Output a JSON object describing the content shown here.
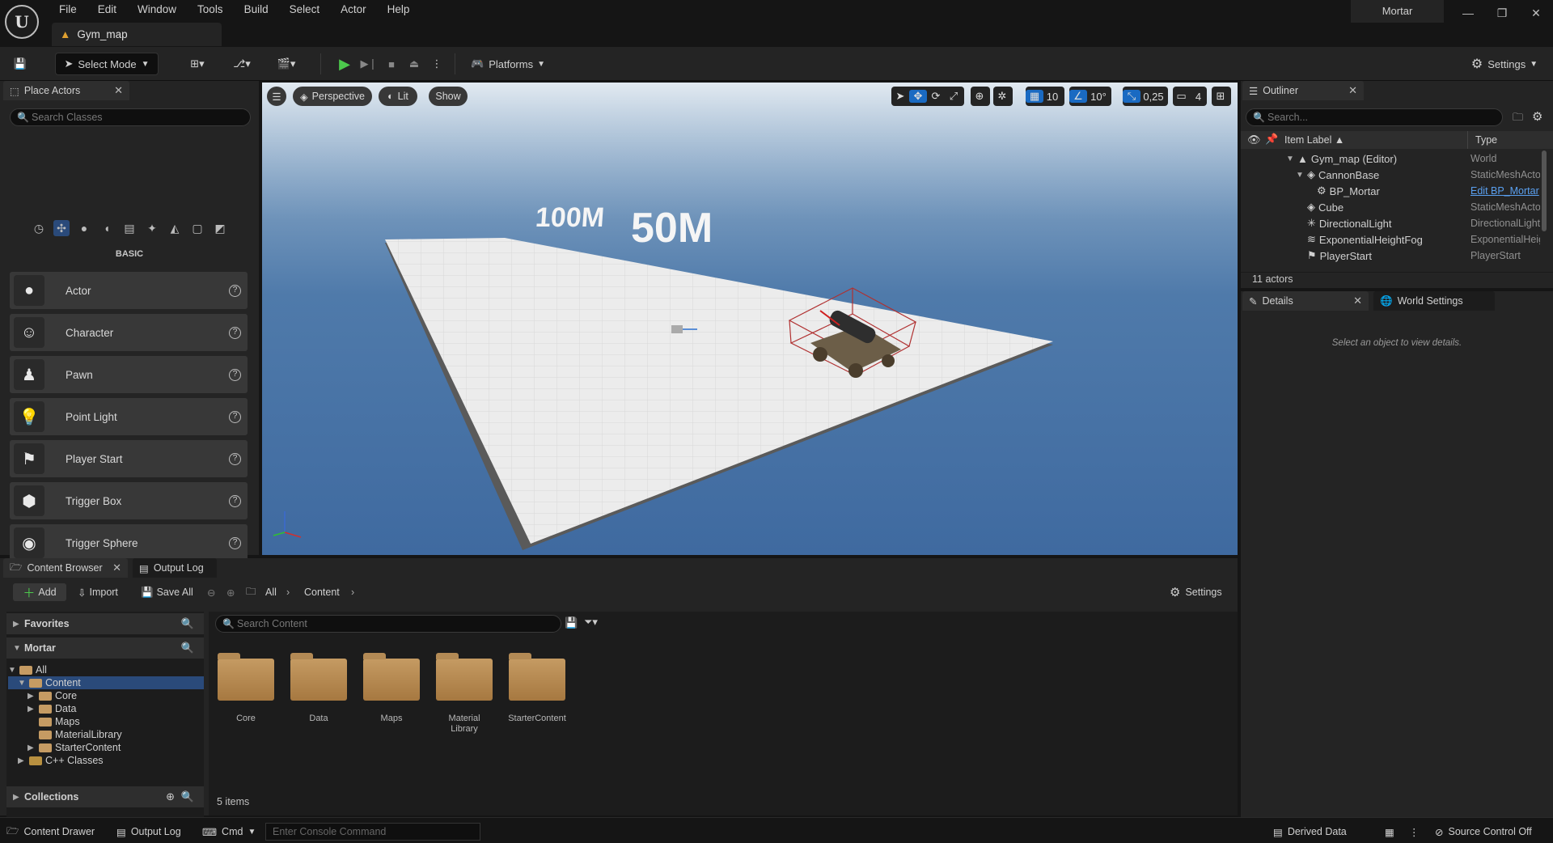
{
  "app": {
    "menu": [
      "File",
      "Edit",
      "Window",
      "Tools",
      "Build",
      "Select",
      "Actor",
      "Help"
    ],
    "map_tab": "Gym_map",
    "project": "Mortar"
  },
  "toolbar": {
    "select_mode": "Select Mode",
    "platforms": "Platforms",
    "settings": "Settings"
  },
  "place_actors": {
    "tab": "Place Actors",
    "search_placeholder": "Search Classes",
    "category": "BASIC",
    "items": [
      {
        "label": "Actor",
        "icon": "sphere-icon"
      },
      {
        "label": "Character",
        "icon": "character-icon"
      },
      {
        "label": "Pawn",
        "icon": "pawn-icon"
      },
      {
        "label": "Point Light",
        "icon": "bulb-icon"
      },
      {
        "label": "Player Start",
        "icon": "player-start-icon"
      },
      {
        "label": "Trigger Box",
        "icon": "cube-icon"
      },
      {
        "label": "Trigger Sphere",
        "icon": "sphere-icon"
      }
    ]
  },
  "viewport": {
    "perspective": "Perspective",
    "lit": "Lit",
    "show": "Show",
    "grid_snap": "10",
    "rot_snap": "10°",
    "scale_snap": "0,25",
    "cam_speed": "4",
    "label_100m": "100M",
    "label_50m": "50M"
  },
  "outliner": {
    "tab": "Outliner",
    "search_placeholder": "Search...",
    "col_label": "Item Label ▲",
    "col_type": "Type",
    "rows": [
      {
        "label": "Gym_map (Editor)",
        "type": "World"
      },
      {
        "label": "CannonBase",
        "type": "StaticMeshActor"
      },
      {
        "label": "BP_Mortar",
        "type": "Edit BP_Mortar"
      },
      {
        "label": "Cube",
        "type": "StaticMeshActor"
      },
      {
        "label": "DirectionalLight",
        "type": "DirectionalLight"
      },
      {
        "label": "ExponentialHeightFog",
        "type": "ExponentialHeightFog"
      },
      {
        "label": "PlayerStart",
        "type": "PlayerStart"
      }
    ],
    "count": "11 actors"
  },
  "details": {
    "tab": "Details",
    "world_tab": "World Settings",
    "empty": "Select an object to view details."
  },
  "content_browser": {
    "tab": "Content Browser",
    "output_tab": "Output Log",
    "add": "Add",
    "import": "Import",
    "save_all": "Save All",
    "crumbs": [
      "All",
      "Content"
    ],
    "settings": "Settings",
    "favorites": "Favorites",
    "mortar": "Mortar",
    "tree": [
      "All",
      "Content",
      "Core",
      "Data",
      "Maps",
      "MaterialLibrary",
      "StarterContent",
      "C++ Classes"
    ],
    "search_placeholder": "Search Content",
    "folders": [
      "Core",
      "Data",
      "Maps",
      "Material Library",
      "StarterContent"
    ],
    "collections": "Collections",
    "items_count": "5 items"
  },
  "statusbar": {
    "content_drawer": "Content Drawer",
    "output_log": "Output Log",
    "cmd": "Cmd",
    "console_placeholder": "Enter Console Command",
    "derived_data": "Derived Data",
    "source_control": "Source Control Off"
  }
}
